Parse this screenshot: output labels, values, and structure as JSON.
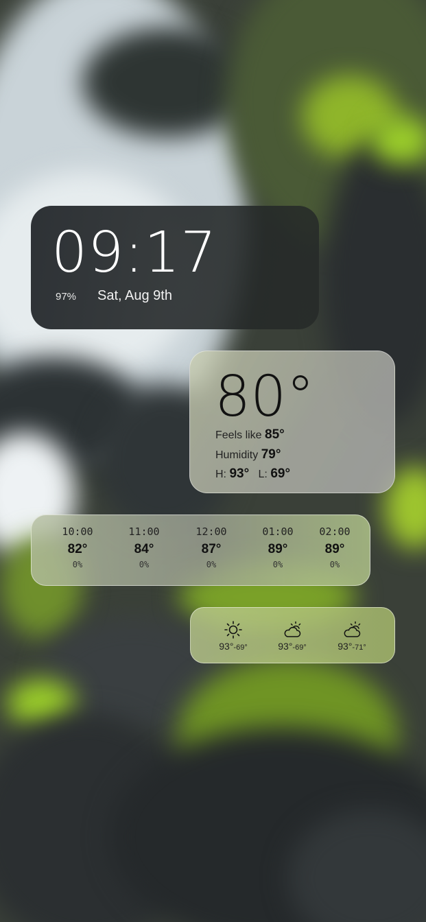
{
  "clock": {
    "time": "09:17",
    "battery": "97%",
    "date": "Sat, Aug 9th"
  },
  "current": {
    "temp": "80°",
    "feels_label": "Feels like",
    "feels_value": "85°",
    "humidity_label": "Humidity",
    "humidity_value": "79°",
    "high_label": "H:",
    "high_value": "93°",
    "low_label": "L:",
    "low_value": "69°"
  },
  "hourly": [
    {
      "time": "10:00",
      "temp": "82°",
      "pop": "0%"
    },
    {
      "time": "11:00",
      "temp": "84°",
      "pop": "0%"
    },
    {
      "time": "12:00",
      "temp": "87°",
      "pop": "0%"
    },
    {
      "time": "01:00",
      "temp": "89°",
      "pop": "0%"
    },
    {
      "time": "02:00",
      "temp": "89°",
      "pop": "0%"
    }
  ],
  "daily": [
    {
      "icon": "sun-icon",
      "high": "93°",
      "low": "-69°"
    },
    {
      "icon": "partly-cloudy-icon",
      "high": "93°",
      "low": "-69°"
    },
    {
      "icon": "partly-cloudy-icon",
      "high": "93°",
      "low": "-71°"
    }
  ],
  "colors": {
    "clock_bg": "#1f2327",
    "glass_green": "#b8c48c",
    "moss": "#8fb52a",
    "rock": "#2b2f31"
  }
}
